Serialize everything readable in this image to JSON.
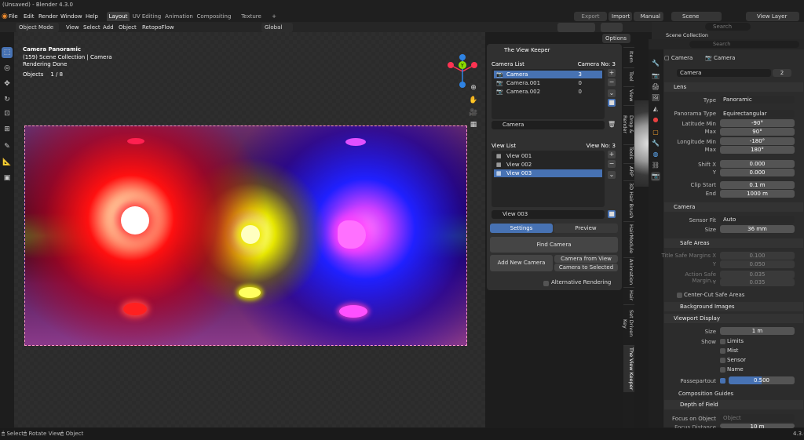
{
  "app": {
    "title": "(Unsaved) - Blender 4.3.0"
  },
  "menu": [
    "File",
    "Edit",
    "Render",
    "Window",
    "Help"
  ],
  "workspaces": [
    "Layout",
    "UV Editing",
    "Animation",
    "Compositing",
    "Texture Paint",
    "+"
  ],
  "topright": {
    "export": "Export",
    "import": "Import",
    "manual": "Manual",
    "scene": "Scene",
    "view_layer": "View Layer"
  },
  "header": {
    "mode": "Object Mode",
    "view": "View",
    "select": "Select",
    "add": "Add",
    "object": "Object",
    "retopoflow": "RetopoFlow",
    "orientation": "Global",
    "options": "Options"
  },
  "viewport": {
    "line1": "Camera Panoramic",
    "line2": "(159) Scene Collection | Camera",
    "line3": "Rendering Done",
    "objects_label": "Objects",
    "objects_value": "1 / 8"
  },
  "gizmo": {
    "x": "X",
    "y": "Y",
    "z": "Z"
  },
  "viewkeeper": {
    "title": "The View Keeper",
    "camera_list_label": "Camera List",
    "camera_no_label": "Camera No:",
    "camera_no": "3",
    "cameras": [
      {
        "name": "Camera",
        "num": "3"
      },
      {
        "name": "Camera.001",
        "num": "0"
      },
      {
        "name": "Camera.002",
        "num": "0"
      }
    ],
    "camera_field": "Camera",
    "view_list_label": "View List",
    "view_no_label": "View No:",
    "view_no": "3",
    "views": [
      {
        "name": "View 001"
      },
      {
        "name": "View 002"
      },
      {
        "name": "View 003"
      }
    ],
    "view_field": "View 003",
    "tab_settings": "Settings",
    "tab_preview": "Preview",
    "find_camera": "Find Camera",
    "add_new_camera": "Add New Camera",
    "camera_from_view": "Camera from View",
    "camera_to_selected": "Camera to Selected",
    "alt_render": "Alternative Rendering"
  },
  "vtabs": [
    "Item",
    "Tool",
    "View",
    "Drop & Render",
    "Tools",
    "ARP",
    "3D Hair Brush",
    "HairModule",
    "Animation",
    "Hair",
    "Set Driven Key",
    "The View Keeper"
  ],
  "outliner": {
    "search_placeholder": "Search",
    "scene_collection": "Scene Collection"
  },
  "props": {
    "search_placeholder": "Search",
    "breadcrumb_obj": "Camera",
    "breadcrumb_data": "Camera",
    "data_name": "Camera",
    "users": "2",
    "lens": "Lens",
    "type_label": "Type",
    "type": "Panoramic",
    "panorama_type_label": "Panorama Type",
    "panorama_type": "Equirectangular",
    "lat_min_label": "Latitude Min",
    "lat_min": "-90°",
    "lat_max_label": "Max",
    "lat_max": "90°",
    "lon_min_label": "Longitude Min",
    "lon_min": "-180°",
    "lon_max_label": "Max",
    "lon_max": "180°",
    "shift_x_label": "Shift X",
    "shift_x": "0.000",
    "shift_y_label": "Y",
    "shift_y": "0.000",
    "clip_start_label": "Clip Start",
    "clip_start": "0.1 m",
    "clip_end_label": "End",
    "clip_end": "1000 m",
    "camera_section": "Camera",
    "sensor_fit_label": "Sensor Fit",
    "sensor_fit": "Auto",
    "size_label": "Size",
    "size": "36 mm",
    "safe_areas": "Safe Areas",
    "title_safe_x_label": "Title Safe Margins X",
    "title_safe_x": "0.100",
    "title_safe_y_label": "Y",
    "title_safe_y": "0.050",
    "action_safe_x_label": "Action Safe Margin...",
    "action_safe_x": "0.035",
    "action_safe_y_label": "Y",
    "action_safe_y": "0.035",
    "center_cut": "Center-Cut Safe Areas",
    "background_images": "Background Images",
    "viewport_display": "Viewport Display",
    "vd_size_label": "Size",
    "vd_size": "1 m",
    "show_label": "Show",
    "limits": "Limits",
    "mist": "Mist",
    "sensor": "Sensor",
    "name": "Name",
    "passepartout_label": "Passepartout",
    "passepartout": "0.500",
    "composition_guides": "Composition Guides",
    "depth_of_field": "Depth of Field",
    "focus_on_object_label": "Focus on Object",
    "focus_on_object": "Object",
    "focus_distance_label": "Focus Distance",
    "focus_distance": "10 m"
  },
  "status": {
    "select": "Select",
    "rotate": "Rotate View",
    "object": "Object",
    "version": "4.3.0"
  }
}
